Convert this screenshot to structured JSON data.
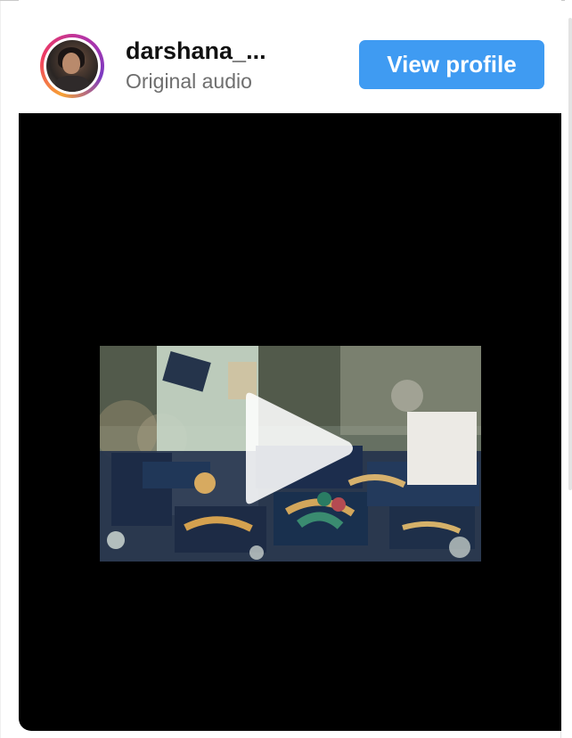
{
  "header": {
    "username": "darshana_...",
    "audio_label": "Original audio",
    "view_profile_label": "View profile"
  },
  "icons": {
    "avatar": "avatar-photo",
    "play": "play-icon"
  },
  "colors": {
    "accent": "#3f9bf2",
    "video_background": "#000000"
  }
}
